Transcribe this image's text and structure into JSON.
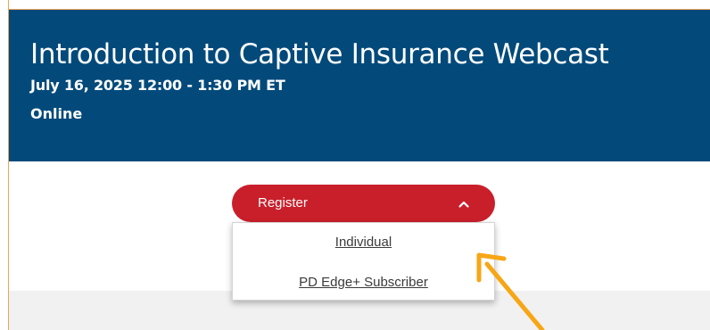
{
  "event": {
    "title": "Introduction to Captive Insurance Webcast",
    "date_time": "July 16, 2025 12:00 - 1:30 PM ET",
    "location": "Online"
  },
  "register": {
    "label": "Register",
    "expanded": true,
    "options": [
      {
        "label": "Individual"
      },
      {
        "label": "PD Edge+ Subscriber"
      }
    ]
  },
  "colors": {
    "header_bg": "#034a7b",
    "button_red": "#c91f2b",
    "annotation_arrow": "#f7a616",
    "frame_border": "#f0a25a"
  },
  "icons": {
    "chevron": "chevron-up-icon",
    "annotation": "pointer-arrow-icon"
  }
}
